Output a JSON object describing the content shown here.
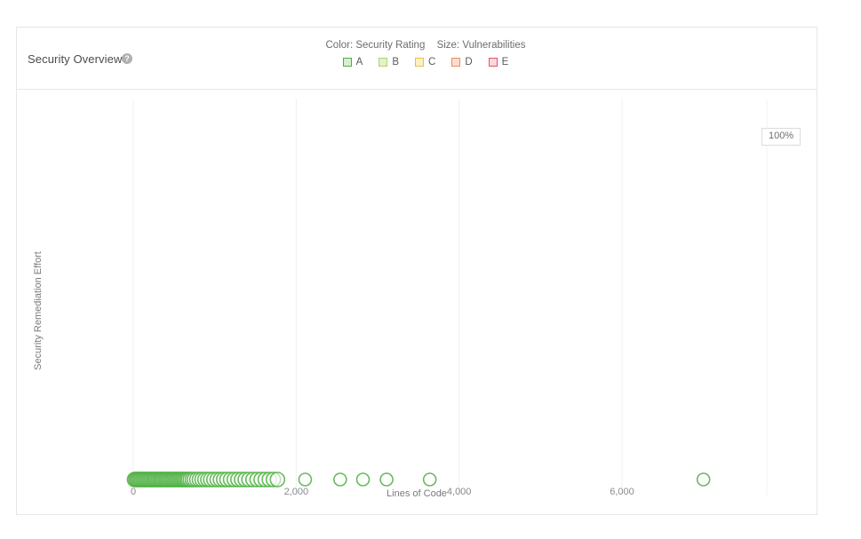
{
  "card": {
    "title": "Security Overview",
    "help_icon": "help-circle-icon",
    "help_glyph": "?"
  },
  "legend": {
    "color_caption": "Color: Security Rating",
    "size_caption": "Size: Vulnerabilities",
    "items": [
      {
        "label": "A",
        "fill": "#d9eed1",
        "border": "#4caf3f"
      },
      {
        "label": "B",
        "fill": "#e4f0ce",
        "border": "#b0d46a"
      },
      {
        "label": "C",
        "fill": "#fbf0c4",
        "border": "#eabe47"
      },
      {
        "label": "D",
        "fill": "#fbded0",
        "border": "#ec8a5f"
      },
      {
        "label": "E",
        "fill": "#fbd7dd",
        "border": "#e4536a"
      }
    ]
  },
  "badge": {
    "zoom_label": "100%"
  },
  "chart_data": {
    "type": "scatter",
    "title": "Security Overview",
    "xlabel": "Lines of Code",
    "ylabel": "Security Remediation Effort",
    "xlim": [
      0,
      7600
    ],
    "ylim": [
      0,
      100
    ],
    "xticks": [
      0,
      2000,
      4000,
      6000
    ],
    "xticklabels": [
      "0",
      "2,000",
      "4,000",
      "6,000"
    ],
    "yticks": [],
    "yticklabels": [],
    "grid": "vertical-only",
    "legend_position": "top-center",
    "gridline_color": "#f0f0f0",
    "bubble_color": "#4caf3f",
    "bubble_fill": "#ffffff",
    "annotations": [
      {
        "text": "100%",
        "position": "top-right",
        "type": "zoom-badge"
      }
    ],
    "series": [
      {
        "name": "A",
        "color": "#4caf3f",
        "points": [
          {
            "x": 15,
            "y": 0,
            "r": 8
          },
          {
            "x": 32,
            "y": 0,
            "r": 8
          },
          {
            "x": 48,
            "y": 0,
            "r": 8
          },
          {
            "x": 65,
            "y": 0,
            "r": 8
          },
          {
            "x": 82,
            "y": 0,
            "r": 8
          },
          {
            "x": 100,
            "y": 0,
            "r": 8
          },
          {
            "x": 118,
            "y": 0,
            "r": 8
          },
          {
            "x": 135,
            "y": 0,
            "r": 8
          },
          {
            "x": 152,
            "y": 0,
            "r": 8
          },
          {
            "x": 170,
            "y": 0,
            "r": 8
          },
          {
            "x": 188,
            "y": 0,
            "r": 8
          },
          {
            "x": 205,
            "y": 0,
            "r": 8
          },
          {
            "x": 222,
            "y": 0,
            "r": 8
          },
          {
            "x": 240,
            "y": 0,
            "r": 8
          },
          {
            "x": 258,
            "y": 0,
            "r": 8
          },
          {
            "x": 275,
            "y": 0,
            "r": 8
          },
          {
            "x": 292,
            "y": 0,
            "r": 8
          },
          {
            "x": 310,
            "y": 0,
            "r": 8
          },
          {
            "x": 328,
            "y": 0,
            "r": 8
          },
          {
            "x": 345,
            "y": 0,
            "r": 8
          },
          {
            "x": 362,
            "y": 0,
            "r": 8
          },
          {
            "x": 380,
            "y": 0,
            "r": 8
          },
          {
            "x": 398,
            "y": 0,
            "r": 8
          },
          {
            "x": 415,
            "y": 0,
            "r": 8
          },
          {
            "x": 432,
            "y": 0,
            "r": 8
          },
          {
            "x": 450,
            "y": 0,
            "r": 8
          },
          {
            "x": 468,
            "y": 0,
            "r": 8
          },
          {
            "x": 485,
            "y": 0,
            "r": 8
          },
          {
            "x": 502,
            "y": 0,
            "r": 8
          },
          {
            "x": 520,
            "y": 0,
            "r": 8
          },
          {
            "x": 538,
            "y": 0,
            "r": 8
          },
          {
            "x": 555,
            "y": 0,
            "r": 8
          },
          {
            "x": 572,
            "y": 0,
            "r": 8
          },
          {
            "x": 590,
            "y": 0,
            "r": 8
          },
          {
            "x": 608,
            "y": 0,
            "r": 8
          },
          {
            "x": 625,
            "y": 0,
            "r": 8
          },
          {
            "x": 642,
            "y": 0,
            "r": 8
          },
          {
            "x": 660,
            "y": 0,
            "r": 8
          },
          {
            "x": 678,
            "y": 0,
            "r": 8
          },
          {
            "x": 700,
            "y": 0,
            "r": 8
          },
          {
            "x": 725,
            "y": 0,
            "r": 8
          },
          {
            "x": 750,
            "y": 0,
            "r": 8
          },
          {
            "x": 780,
            "y": 0,
            "r": 8
          },
          {
            "x": 812,
            "y": 0,
            "r": 8
          },
          {
            "x": 845,
            "y": 0,
            "r": 8
          },
          {
            "x": 880,
            "y": 0,
            "r": 8
          },
          {
            "x": 915,
            "y": 0,
            "r": 8
          },
          {
            "x": 950,
            "y": 0,
            "r": 8
          },
          {
            "x": 990,
            "y": 0,
            "r": 8
          },
          {
            "x": 1030,
            "y": 0,
            "r": 8
          },
          {
            "x": 1070,
            "y": 0,
            "r": 8
          },
          {
            "x": 1110,
            "y": 0,
            "r": 8
          },
          {
            "x": 1150,
            "y": 0,
            "r": 8
          },
          {
            "x": 1195,
            "y": 0,
            "r": 8
          },
          {
            "x": 1240,
            "y": 0,
            "r": 8
          },
          {
            "x": 1285,
            "y": 0,
            "r": 8
          },
          {
            "x": 1330,
            "y": 0,
            "r": 8
          },
          {
            "x": 1375,
            "y": 0,
            "r": 8
          },
          {
            "x": 1420,
            "y": 0,
            "r": 8
          },
          {
            "x": 1470,
            "y": 0,
            "r": 8
          },
          {
            "x": 1520,
            "y": 0,
            "r": 8
          },
          {
            "x": 1570,
            "y": 0,
            "r": 8
          },
          {
            "x": 1620,
            "y": 0,
            "r": 8
          },
          {
            "x": 1670,
            "y": 0,
            "r": 8
          },
          {
            "x": 1720,
            "y": 0,
            "r": 8
          },
          {
            "x": 1770,
            "y": 0,
            "r": 8
          },
          {
            "x": 2110,
            "y": 0,
            "r": 7
          },
          {
            "x": 2540,
            "y": 0,
            "r": 7
          },
          {
            "x": 2820,
            "y": 0,
            "r": 7
          },
          {
            "x": 3110,
            "y": 0,
            "r": 7
          },
          {
            "x": 3640,
            "y": 0,
            "r": 7
          },
          {
            "x": 7000,
            "y": 0,
            "r": 7
          }
        ]
      }
    ]
  }
}
